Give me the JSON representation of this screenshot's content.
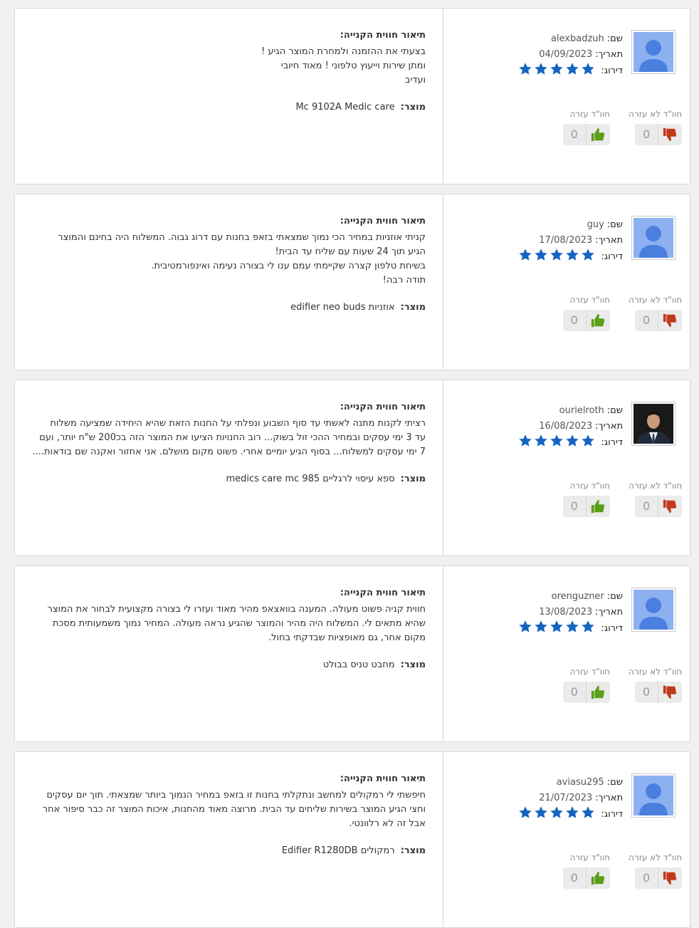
{
  "labels": {
    "name": "שם:",
    "date": "תאריך:",
    "rating": "דירוג:",
    "not_helpful": "חוו\"ד לא עזרה",
    "helpful": "חוו\"ד עזרה",
    "description_title": "תיאור חווית הקנייה:",
    "product": "מוצר:"
  },
  "colors": {
    "star": "#1565c0",
    "thumb_up": "#5a9e1a",
    "thumb_down": "#c0391b",
    "avatar_bg": "#8db0f0",
    "avatar_fg": "#4a7fe0"
  },
  "reviews": [
    {
      "name": "alexbadzuh",
      "date": "04/09/2023",
      "rating": 5,
      "avatar": "default-user-avatar",
      "not_helpful_count": "0",
      "helpful_count": "0",
      "text_lines": [
        "בצעתי את ההזמנה ולמחרת המוצר הגיע !",
        "ומתן שירות וייעוץ טלפוני ! מאוד חיובי",
        "ועדיב"
      ],
      "product": "Mc 9102A Medic care"
    },
    {
      "name": "guy",
      "date": "17/08/2023",
      "rating": 5,
      "avatar": "default-user-avatar",
      "not_helpful_count": "0",
      "helpful_count": "0",
      "text_lines": [
        "קניתי אוזניות במחיר הכי נמוך שמצאתי בזאפ בחנות עם דרוג גבוה. המשלוח היה בחינם והמוצר",
        "הגיע תוך 24 שעות עם שליח עד הבית!",
        "בשיחת טלפון קצרה שקיימתי עמם ענו לי בצורה נעימה ואינפורמטיבית.",
        "תודה רבה!"
      ],
      "product": "אוזניות edifier neo buds"
    },
    {
      "name": "ourielroth",
      "date": "16/08/2023",
      "rating": 5,
      "avatar": "user-photo-avatar",
      "not_helpful_count": "0",
      "helpful_count": "0",
      "text_lines": [
        "רציתי לקנות מתנה לאשתי עד סוף השבוע ונפלתי על החנות הזאת שהיא היחידה שמציעה משלוח",
        "עד 3 ימי עסקים ובמחיר ההכי זול בשוק... רוב החנויות הציעו את המוצר הזה בכ200 ש\"ח יותר, ועם",
        "7 ימי עסקים למשלוח... בסוף הגיע יומיים אחרי. פשוט מקום מושלם. אני אחזור ואקנה שם בודאות...."
      ],
      "product": "ספא עיסוי לרגליים medics care mc 985"
    },
    {
      "name": "orenguzner",
      "date": "13/08/2023",
      "rating": 5,
      "avatar": "default-user-avatar",
      "not_helpful_count": "0",
      "helpful_count": "0",
      "text_lines": [
        "חווית קניה פשוט מעולה. המענה בוואצאפ מהיר מאוד ועזרו לי בצורה מקצועית לבחור את המוצר",
        "שהיא מתאים לי. המשלוח היה מהיר והמוצר שהגיע נראה מעולה. המחיר נמוך משמעותית מסכת",
        "מקום אחר, גם מאופציות שבדקתי בחול."
      ],
      "product": "מחבט טניס בבולט"
    },
    {
      "name": "aviasu295",
      "date": "21/07/2023",
      "rating": 5,
      "avatar": "default-user-avatar",
      "not_helpful_count": "0",
      "helpful_count": "0",
      "text_lines": [
        "חיפשתי לי רמקולים למחשב ונתקלתי בחנות זו בזאפ במחיר הנמוך ביותר שמצאתי. תוך יום עסקים",
        "וחצי הגיע המוצר בשירות שליחים עד הבית. מרוצה מאוד מהחנות, איכות המוצר זה כבר סיפור אחר",
        "אבל זה לא רלוונטי."
      ],
      "product": "רמקולים Edifier R1280DB"
    }
  ]
}
